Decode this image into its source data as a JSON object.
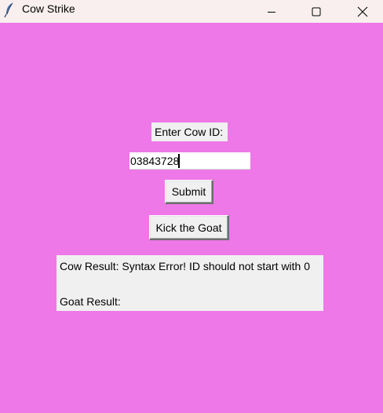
{
  "window": {
    "title": "Cow Strike",
    "icon": "feather-icon",
    "controls": [
      "minimize-icon",
      "maximize-icon",
      "close-icon"
    ]
  },
  "form": {
    "prompt_label": "Enter Cow ID:",
    "cow_id_value": "03843728",
    "submit_label": "Submit",
    "kick_label": "Kick the Goat"
  },
  "results": {
    "cow_result": "Cow Result: Syntax Error! ID should not start with 0",
    "goat_result": "Goat Result:"
  },
  "colors": {
    "background": "#ee78e8",
    "titlebar": "#f9efef",
    "widget": "#f0f0f0"
  }
}
